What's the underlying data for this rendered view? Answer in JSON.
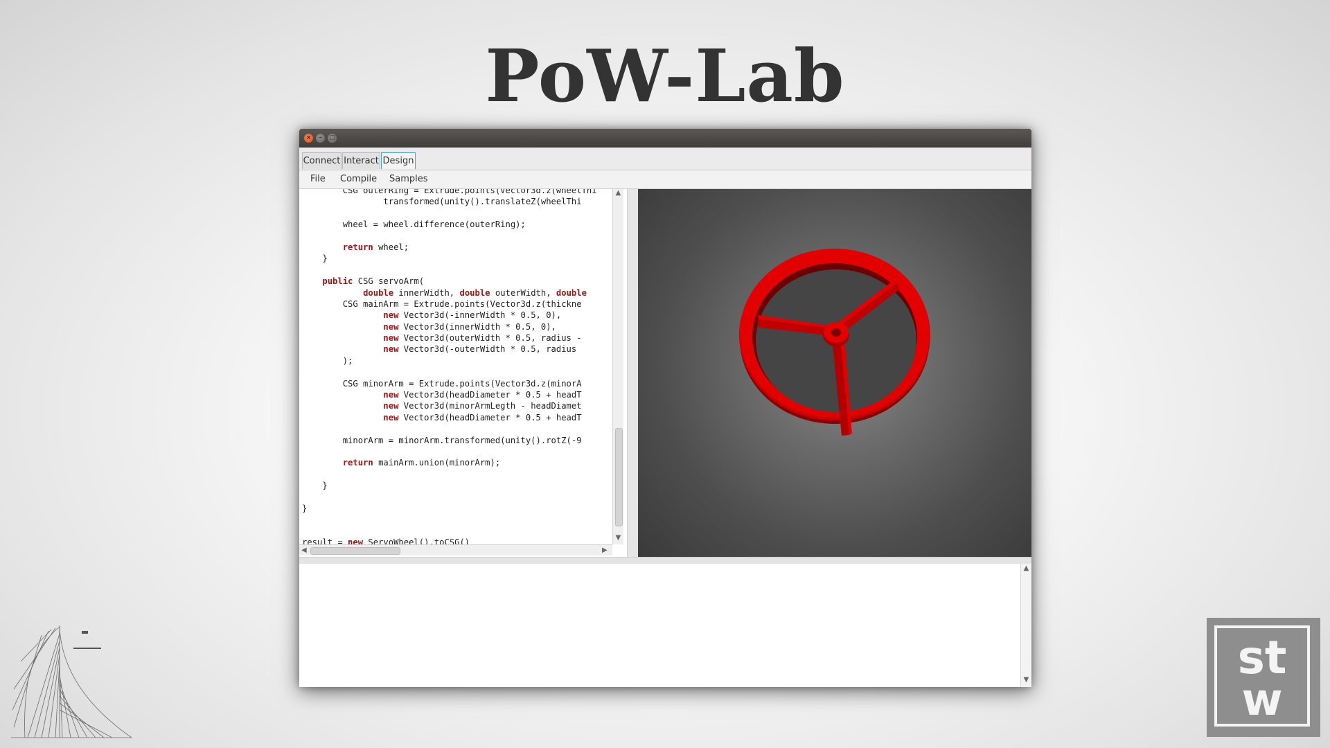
{
  "slide": {
    "title": "PoW-Lab"
  },
  "window": {
    "controls": {
      "close": "×",
      "minimize": "–",
      "maximize": "□"
    }
  },
  "tabs": [
    {
      "label": "Connect",
      "active": false
    },
    {
      "label": "Interact",
      "active": false
    },
    {
      "label": "Design",
      "active": true
    }
  ],
  "menu": [
    "File",
    "Compile",
    "Samples"
  ],
  "editor": {
    "lines": [
      [
        {
          "t": "        CSG outerRing = Extrude.points(Vector3d.z(wheelThi"
        }
      ],
      [
        {
          "t": "                transformed(unity().translateZ(wheelThi"
        }
      ],
      [
        {
          "t": ""
        }
      ],
      [
        {
          "t": "        wheel = wheel.difference(outerRing);"
        }
      ],
      [
        {
          "t": ""
        }
      ],
      [
        {
          "t": "        "
        },
        {
          "t": "return",
          "k": 1
        },
        {
          "t": " wheel;"
        }
      ],
      [
        {
          "t": "    }"
        }
      ],
      [
        {
          "t": ""
        }
      ],
      [
        {
          "t": "    "
        },
        {
          "t": "public",
          "k": 1
        },
        {
          "t": " CSG servoArm("
        }
      ],
      [
        {
          "t": "            "
        },
        {
          "t": "double",
          "k": 1
        },
        {
          "t": " innerWidth, "
        },
        {
          "t": "double",
          "k": 1
        },
        {
          "t": " outerWidth, "
        },
        {
          "t": "double",
          "k": 1
        }
      ],
      [
        {
          "t": "        CSG mainArm = Extrude.points(Vector3d.z(thickne"
        }
      ],
      [
        {
          "t": "                "
        },
        {
          "t": "new",
          "k": 1
        },
        {
          "t": " Vector3d(-innerWidth * 0.5, 0),"
        }
      ],
      [
        {
          "t": "                "
        },
        {
          "t": "new",
          "k": 1
        },
        {
          "t": " Vector3d(innerWidth * 0.5, 0),"
        }
      ],
      [
        {
          "t": "                "
        },
        {
          "t": "new",
          "k": 1
        },
        {
          "t": " Vector3d(outerWidth * 0.5, radius -"
        }
      ],
      [
        {
          "t": "                "
        },
        {
          "t": "new",
          "k": 1
        },
        {
          "t": " Vector3d(-outerWidth * 0.5, radius"
        }
      ],
      [
        {
          "t": "        );"
        }
      ],
      [
        {
          "t": ""
        }
      ],
      [
        {
          "t": "        CSG minorArm = Extrude.points(Vector3d.z(minorA"
        }
      ],
      [
        {
          "t": "                "
        },
        {
          "t": "new",
          "k": 1
        },
        {
          "t": " Vector3d(headDiameter * 0.5 + headT"
        }
      ],
      [
        {
          "t": "                "
        },
        {
          "t": "new",
          "k": 1
        },
        {
          "t": " Vector3d(minorArmLegth - headDiamet"
        }
      ],
      [
        {
          "t": "                "
        },
        {
          "t": "new",
          "k": 1
        },
        {
          "t": " Vector3d(headDiameter * 0.5 + headT"
        }
      ],
      [
        {
          "t": ""
        }
      ],
      [
        {
          "t": "        minorArm = minorArm.transformed(unity().rotZ(-9"
        }
      ],
      [
        {
          "t": ""
        }
      ],
      [
        {
          "t": "        "
        },
        {
          "t": "return",
          "k": 1
        },
        {
          "t": " mainArm.union(minorArm);"
        }
      ],
      [
        {
          "t": ""
        }
      ],
      [
        {
          "t": "    }"
        }
      ],
      [
        {
          "t": ""
        }
      ],
      [
        {
          "t": "}"
        }
      ],
      [
        {
          "t": ""
        }
      ],
      [
        {
          "t": ""
        }
      ],
      [
        {
          "t": "result = "
        },
        {
          "t": "new",
          "k": 1
        },
        {
          "t": " ServoWheel().toCSG()"
        }
      ]
    ]
  },
  "scrollbars": {
    "up": "▲",
    "down": "▼",
    "left": "◀",
    "right": "▶"
  },
  "viewport": {
    "object": "servo wheel",
    "color": "#e00000",
    "background": "#5a5a5a"
  },
  "logos": {
    "right_line1": "st",
    "right_line2": "w"
  },
  "colors": {
    "keyword": "#a01515",
    "active_tab_border": "#4a9fd8"
  }
}
